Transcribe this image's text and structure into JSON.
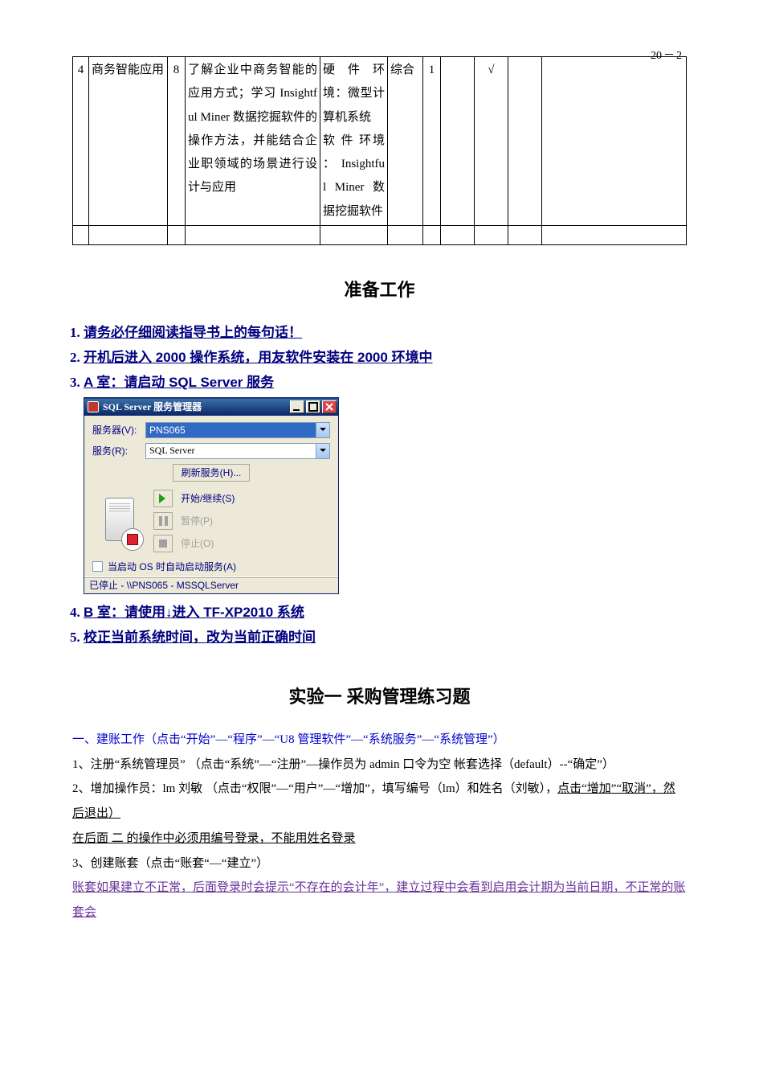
{
  "page_number": {
    "a": "20",
    "b": "2"
  },
  "table": {
    "row": {
      "idx": "4",
      "title": "商务智能应用",
      "hours": "8",
      "objective": "了解企业中商务智能的应用方式；学习 Insightful Miner 数据挖掘软件的操作方法，并能结合企业职领域的场景进行设计与应用",
      "env": "硬 件 环境：微型计算机系统\n软 件 环境 ： Insightful Miner 数据挖掘软件",
      "type": "综合",
      "g": "1",
      "h": "",
      "i": "√",
      "j": "",
      "k": ""
    }
  },
  "section_prep_title": "准备工作",
  "prep": {
    "p1": "请务必仔细阅读指导书上的每句话！",
    "p2": "开机后进入 2000 操作系统，用友软件安装在 2000 环境中",
    "p3": "A 室：请启动 SQL Server 服务",
    "p4": "B 室：请使用↓进入 TF-XP2010 系统",
    "p5": "校正当前系统时间，改为当前正确时间"
  },
  "dlg": {
    "title": "SQL Server 服务管理器",
    "server_label": "服务器(V):",
    "server_value": "PNS065",
    "service_label": "服务(R):",
    "service_value": "SQL Server",
    "refresh": "刷新服务(H)...",
    "start": "开始/继续(S)",
    "pause": "暂停(P)",
    "stop": "停止(O)",
    "autostart": "当启动 OS 时自动启动服务(A)",
    "status": "已停止 - \\\\PNS065 - MSSQLServer"
  },
  "section_exp_title": "实验一  采购管理练习题",
  "steps": {
    "s1": "一、建账工作（点击“开始”—“程序”—“U8 管理软件”—“系统服务”—“系统管理”）",
    "s2a": "1、注册“系统管理员”  （点击“系统”—“注册”—操作员为 admin 口令为空 帐套选择（default）--“确定”）",
    "s2b_pre": "2、增加操作员：lm      刘敏     （点击“权限”—“用户”—“增加”，填写编号（lm）和姓名（刘敏），",
    "s2b_ul": "点击“增加”“取消”，然后退出）",
    "s2c": "在后面  二  的操作中必须用编号登录，不能用姓名登录",
    "s3": "3、创建账套（点击“账套“—“建立”）",
    "s4": "账套如果建立不正常，后面登录时会提示“不存在的会计年”，建立过程中会看到启用会计期为当前日期，不正常的账套会"
  }
}
